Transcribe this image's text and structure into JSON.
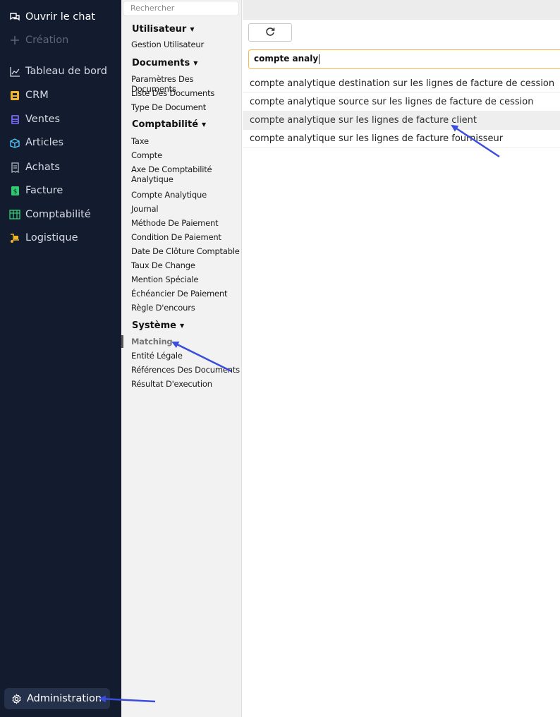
{
  "nav": {
    "items": [
      {
        "label": "Ouvrir le chat",
        "icon": "chat-icon"
      },
      {
        "label": "Création",
        "icon": "plus-icon"
      },
      {
        "label": "Tableau de bord",
        "icon": "chart-line-icon"
      },
      {
        "label": "CRM",
        "icon": "contact-card-icon"
      },
      {
        "label": "Ventes",
        "icon": "calculator-icon"
      },
      {
        "label": "Articles",
        "icon": "box-icon"
      },
      {
        "label": "Achats",
        "icon": "receipt-icon"
      },
      {
        "label": "Facture",
        "icon": "invoice-icon"
      },
      {
        "label": "Comptabilité",
        "icon": "ledger-icon"
      },
      {
        "label": "Logistique",
        "icon": "truck-icon"
      }
    ],
    "admin_label": "Administration"
  },
  "sidebar": {
    "search_placeholder": "Rechercher",
    "sections": [
      {
        "title": "Utilisateur",
        "items": [
          "Gestion Utilisateur"
        ]
      },
      {
        "title": "Documents",
        "items": [
          "Paramètres Des Documents",
          "Liste Des Documents",
          "Type De Document"
        ]
      },
      {
        "title": "Comptabilité",
        "items": [
          "Taxe",
          "Compte",
          "Axe De Comptabilité Analytique",
          "Compte Analytique",
          "Journal",
          "Méthode De Paiement",
          "Condition De Paiement",
          "Date De Clôture Comptable",
          "Taux De Change",
          "Mention Spéciale",
          "Échéancier De Paiement",
          "Règle D'encours"
        ]
      },
      {
        "title": "Système",
        "items": [
          "Matching",
          "Entité Légale",
          "Références Des Documents",
          "Résultat D'execution"
        ]
      }
    ]
  },
  "main": {
    "search_value": "compte analy",
    "suggestions": [
      "compte analytique destination sur les lignes de facture de cession",
      "compte analytique source sur les lignes de facture de cession",
      "compte analytique sur les lignes de facture client",
      "compte analytique sur les lignes de facture fournisseur"
    ]
  },
  "colors": {
    "nav_bg": "#131c2e",
    "sidebar_bg": "#f2f2f2",
    "search_focus": "#f5b94d",
    "annotation_arrow": "#3b4ddb"
  }
}
